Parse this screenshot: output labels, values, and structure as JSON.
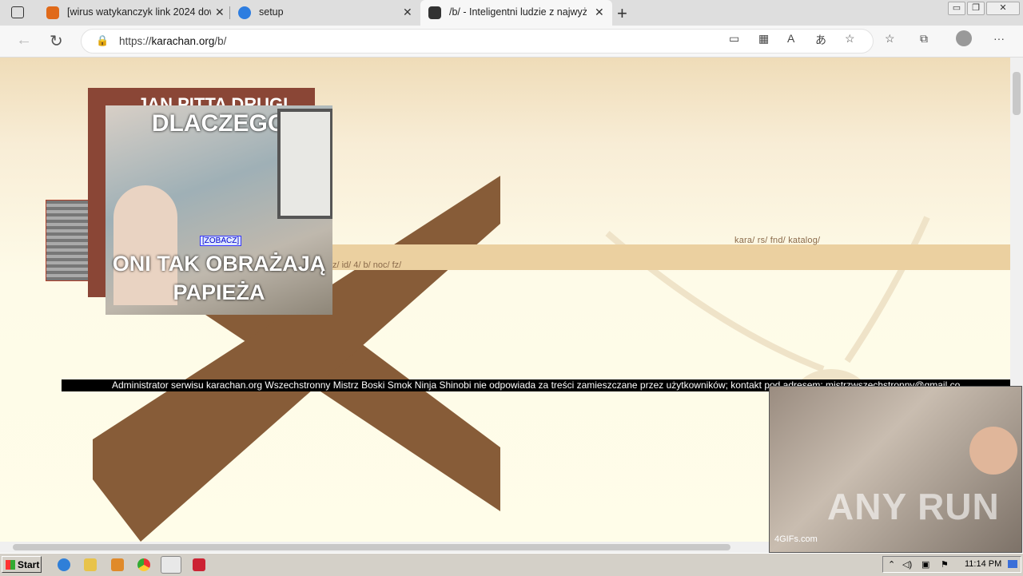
{
  "browser": {
    "tabs": [
      {
        "title": "[wirus watykanczyk link 2024 dow",
        "close": "✕"
      },
      {
        "title": "setup",
        "close": "✕"
      },
      {
        "title": "/b/ - Inteligentni ludzie z najwyż",
        "close": "✕",
        "active": true
      }
    ],
    "new_tab": "+",
    "window_controls": [
      "▭",
      "❐",
      "✕"
    ],
    "url_prefix": "https://",
    "url_domain": "karachan.org",
    "url_path": "/b/"
  },
  "page": {
    "top_nav": "kara/  rs/  fnd/  katalog/",
    "band_nav": "z/  id/  4/  b/  noc/  fz/",
    "meme_top_text": "DLACZEGO",
    "meme_bottom_text": "ONI TAK OBRAŻAJĄ PAPIEŻA",
    "meme_back_text": "JAN PITTA DRUGI",
    "zobacz": "[ZOBACZ]",
    "disclaimer": "Administrator serwisu karachan.org Wszechstronny Mistrz Boski Smok Ninja Shinobi nie odpowiada za treści zamieszczane przez użytkowników; kontakt pod adresem: mistrzwszechstronny@gmail.co",
    "gif_label": "4GIFs.com",
    "watermark": "ANY RUN"
  },
  "taskbar": {
    "start": "Start",
    "clock": "11:14 PM"
  },
  "colors": {
    "x_brown": "#875c38",
    "band": "#ebd0a0"
  }
}
